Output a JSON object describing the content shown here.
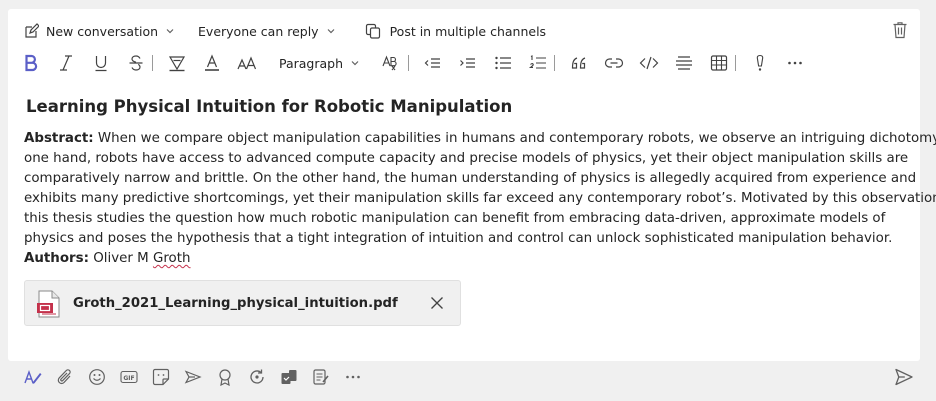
{
  "options": {
    "new_conversation": "New conversation",
    "reply_setting": "Everyone can reply",
    "multi_channel": "Post in multiple channels"
  },
  "toolbar": {
    "paragraph": "Paragraph"
  },
  "post": {
    "title": "Learning Physical Intuition for Robotic Manipulation",
    "abstract_label": "Abstract:",
    "abstract_lines": [
      " When we compare object manipulation capabilities in humans and contemporary robots, we observe an intriguing dichotomy: On",
      "one hand, robots have access to advanced compute capacity and precise models of physics, yet their object manipulation skills are",
      "comparatively narrow and brittle. On the other hand, the human understanding of physics is allegedly acquired from experience and",
      "exhibits many predictive shortcomings, yet their manipulation skills far exceed any contemporary robot’s. Motivated by this observation,",
      "this thesis studies the question how much robotic manipulation can benefit from embracing data-driven, approximate models of",
      "physics and poses the hypothesis that a tight integration of intuition and control can unlock sophisticated manipulation behavior."
    ],
    "authors_label": "Authors:",
    "author_first": " Oliver M ",
    "author_last": "Groth"
  },
  "attachment": {
    "filename": "Groth_2021_Learning_physical_intuition.pdf",
    "file_icon": "pdf-file-icon"
  },
  "colors": {
    "accent": "#5b5fc7",
    "pdf_red": "#c4314b",
    "text": "#242424",
    "icon": "#616161"
  }
}
